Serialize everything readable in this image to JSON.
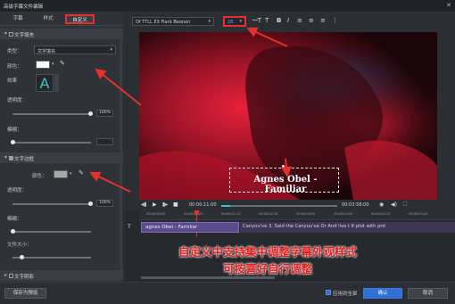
{
  "window": {
    "title": "高级字幕文件编辑",
    "close": "✕"
  },
  "tabs": [
    "字幕",
    "样式",
    "自定义"
  ],
  "sections": {
    "text_fill": "文字填充",
    "text_border": "文字边框",
    "text_shadow": "文字阴影"
  },
  "fill": {
    "type_label": "类型：",
    "type_value": "文字填充",
    "color_label": "颜色：",
    "effect_label": "效果",
    "opacity_label": "透明度：",
    "opacity_value": "100%",
    "opacity_fraction": 1.0,
    "blur_label": "模糊："
  },
  "border": {
    "color_label": "颜色：",
    "color": "#a8a8a8",
    "opacity_label": "透明度：",
    "opacity_value": "100%",
    "opacity_fraction": 1.0,
    "blur_label": "模糊：",
    "size_label": "文件大小："
  },
  "toolbar": {
    "font": "Of TTLL EX Fiant Beanon",
    "size": "28"
  },
  "video": {
    "subtitle": "Agnes Obel - Familiar"
  },
  "transport": {
    "current": "00:00:11:00",
    "total": "00:03:58:00",
    "ticks": [
      "00:00:00:00",
      "00:00:00:20",
      "00:00:01:15",
      "00:00:02:10",
      "00:00:03:05",
      "00:00:04:00",
      "00:00:04:25",
      "00:00:05:20"
    ]
  },
  "timeline": {
    "clip1": "agnes Obel - Familiar",
    "clip2": "Canyou've 3. Said the   Canyou've Or  And live t  It plot with prd"
  },
  "annotation": {
    "line1": "自定义中支持集中调整字幕外观样式",
    "line2": "可按喜好自行调整"
  },
  "bottom": {
    "save_preset": "保存为预设",
    "apply_all": "应用到全部",
    "ok": "确认",
    "cancel": "取消"
  },
  "colors": {
    "accent_red": "#e5312b",
    "primary": "#2f6fd6"
  }
}
